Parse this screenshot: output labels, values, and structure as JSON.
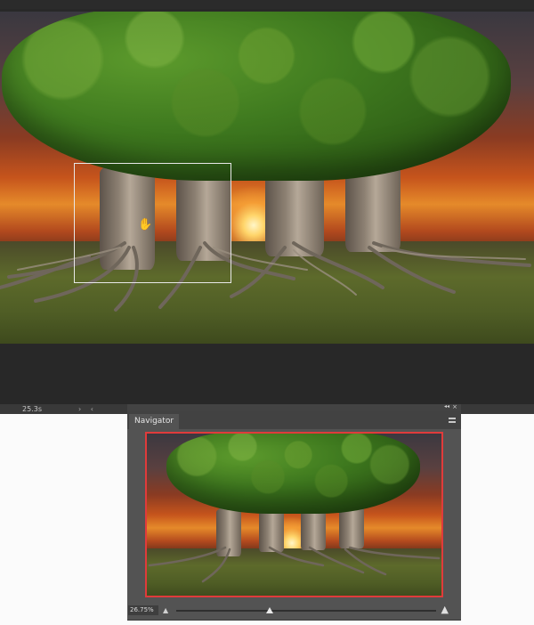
{
  "status_bar": {
    "zoom": "25.3s",
    "arrows": "› ‹"
  },
  "navigator": {
    "tab_label": "Navigator",
    "collapse_symbol": "◂◂",
    "close_symbol": "×",
    "zoom_value": "26.75%",
    "zoom_slider_fraction": 0.36,
    "zoom_out_symbol": "▲",
    "zoom_in_symbol": "▲"
  },
  "colors": {
    "view_box": "#e03b3b",
    "canvas_bg": "#282828",
    "panel_bg": "#535353"
  },
  "icons": {
    "cursor": "hand-icon",
    "panel_menu": "hamburger-icon"
  }
}
